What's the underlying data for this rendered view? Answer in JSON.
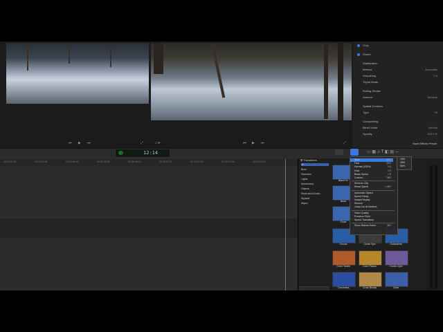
{
  "viewer": {
    "left_timecode": "",
    "right_timecode": "",
    "toolbar_timecode": "12:14"
  },
  "inspector": {
    "rows": [
      {
        "label": "Crop",
        "value": ""
      },
      {
        "label": "Distort",
        "value": ""
      },
      {
        "label": "Stabilization",
        "value": ""
      },
      {
        "label": "Method",
        "value": "Automatic"
      },
      {
        "label": "Smoothing",
        "value": "1.0"
      },
      {
        "label": "Tripod Mode",
        "value": ""
      },
      {
        "label": "Rolling Shutter",
        "value": ""
      },
      {
        "label": "Amount",
        "value": "Medium"
      },
      {
        "label": "Spatial Conform",
        "value": ""
      },
      {
        "label": "Type",
        "value": "Fit"
      },
      {
        "label": "Compositing",
        "value": ""
      },
      {
        "label": "Blend Mode",
        "value": "Normal"
      },
      {
        "label": "Opacity",
        "value": "100.0 %"
      }
    ],
    "save_preset": "Save Effects Preset"
  },
  "timeline": {
    "ticks": [
      "00:00:00:00",
      "00:00:02:00",
      "00:00:04:00",
      "00:00:06:00",
      "00:00:08:00",
      "00:00:10:00",
      "00:00:12:00",
      "00:00:14:00",
      "00:00:16:00"
    ]
  },
  "transitions": {
    "header": "Transitions",
    "categories": [
      "All",
      "Blurs",
      "Dissolves",
      "Lights",
      "Movements",
      "Objects",
      "Replicator/Clones",
      "Stylized",
      "Wipes"
    ],
    "thumbs": [
      {
        "label": "Black Ho"
      },
      {
        "label": "Band"
      },
      {
        "label": "Circle"
      },
      {
        "label": "Clouds",
        "color": "#2a5da8"
      },
      {
        "label": "Clone Spin",
        "color": "#3b3b3b"
      },
      {
        "label": "Clothesline",
        "color": "#2a5da8"
      },
      {
        "label": "Color Panels",
        "color": "#b05a28"
      },
      {
        "label": "Color Planes",
        "color": "#b8862a"
      },
      {
        "label": "Combo Spin",
        "color": "#6d5a9a"
      },
      {
        "label": "Concertina",
        "color": "#2a4da0"
      },
      {
        "label": "Cross Blocks",
        "color": "#b08848"
      },
      {
        "label": "Cube",
        "color": "#3a5fa8"
      }
    ]
  },
  "speed_menu": {
    "items": [
      {
        "label": "Slow",
        "shortcut": "50%"
      },
      {
        "label": "Fast",
        "shortcut": "25%"
      },
      {
        "label": "Normal (100%)",
        "shortcut": "⇧N"
      },
      {
        "label": "Hold",
        "shortcut": "⇧H"
      },
      {
        "label": "Blade Speed",
        "shortcut": "⇧B"
      },
      {
        "label": "Custom...",
        "shortcut": "⌃⌘R"
      },
      {
        "label": "",
        "shortcut": ""
      },
      {
        "label": "Reverse Clip",
        "shortcut": ""
      },
      {
        "label": "Reset Speed",
        "shortcut": "⌥⌘R"
      },
      {
        "label": "",
        "shortcut": ""
      },
      {
        "label": "Automatic Speed",
        "shortcut": ""
      },
      {
        "label": "Speed Ramp",
        "shortcut": ""
      },
      {
        "label": "Instant Replay",
        "shortcut": ""
      },
      {
        "label": "Rewind",
        "shortcut": ""
      },
      {
        "label": "Jump Cut at Markers",
        "shortcut": ""
      },
      {
        "label": "",
        "shortcut": ""
      },
      {
        "label": "Video Quality",
        "shortcut": ""
      },
      {
        "label": "Preserve Pitch",
        "shortcut": ""
      },
      {
        "label": "Speed Transitions",
        "shortcut": ""
      },
      {
        "label": "",
        "shortcut": ""
      },
      {
        "label": "Show Retime Editor",
        "shortcut": "⌘R"
      }
    ],
    "submenu": [
      "10%",
      "25%",
      "50%"
    ]
  },
  "colors": {
    "accent": "#3b7ae0",
    "panel": "#1b1b1b",
    "bg": "#000000"
  }
}
